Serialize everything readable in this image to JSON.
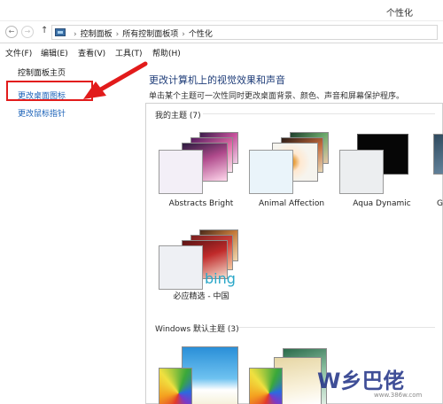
{
  "window": {
    "title": "个性化"
  },
  "address": {
    "crumbs": [
      "控制面板",
      "所有控制面板项",
      "个性化"
    ],
    "separator": "›",
    "back_glyph": "←",
    "forward_glyph": "→",
    "up_glyph": "↑"
  },
  "menu": {
    "file": "文件(F)",
    "edit": "编辑(E)",
    "view": "查看(V)",
    "tools": "工具(T)",
    "help": "帮助(H)"
  },
  "sidebar": {
    "home": "控制面板主页",
    "desktop_icons": "更改桌面图标",
    "mouse_pointer": "更改鼠标指针"
  },
  "main": {
    "heading": "更改计算机上的视觉效果和声音",
    "description": "单击某个主题可一次性同时更改桌面背景、颜色、声音和屏幕保护程序。"
  },
  "groups": {
    "my_themes": "我的主题 (7)",
    "windows_default": "Windows 默认主题 (3)"
  },
  "themes": [
    {
      "name": "Abstracts Bright"
    },
    {
      "name": "Animal Affection"
    },
    {
      "name": "Aqua Dynamic"
    },
    {
      "name": "G"
    },
    {
      "name": "必应精选 - 中国",
      "logo": "bing"
    }
  ],
  "watermark": {
    "text": "W乡巴佬",
    "url": "www.386w.com"
  },
  "colors": {
    "highlight": "#e21b1b",
    "heading": "#1e3c78",
    "link": "#1b62b8",
    "bing": "#2aa7c8"
  }
}
